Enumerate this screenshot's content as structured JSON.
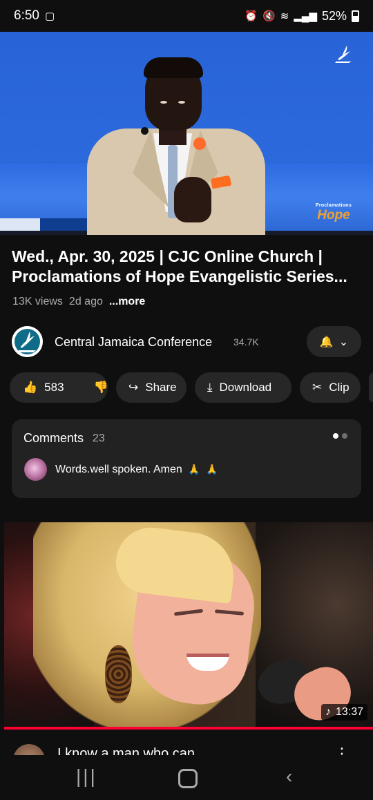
{
  "status_bar": {
    "time": "6:50",
    "left_icon": "screen-cast-icon",
    "right_icons": [
      "alarm-icon",
      "mute-icon",
      "wifi-icon",
      "signal-icon"
    ],
    "battery": "52%"
  },
  "video": {
    "logo_small": "Proclamations",
    "logo_main": "Hope"
  },
  "title": "Wed., Apr. 30, 2025 | CJC Online Church | Proclamations of Hope Evangelistic Series...",
  "meta": {
    "views": "13K views",
    "age": "2d ago",
    "more": "...more"
  },
  "channel": {
    "name": "Central Jamaica Conference",
    "subscribers": "34.7K",
    "bell_icon": "bell-icon",
    "chevron_icon": "chevron-down-icon"
  },
  "actions": {
    "likes": "583",
    "share": "Share",
    "download": "Download",
    "clip": "Clip"
  },
  "comments": {
    "title": "Comments",
    "count": "23",
    "text": "Words.well spoken.  Amen"
  },
  "next_video": {
    "duration": "13:37",
    "title": "I know a man who can",
    "music_icon": "music-note-icon"
  },
  "colors": {
    "background": "#0f0f0f",
    "pill": "#272727",
    "accent_red": "#ff0033"
  }
}
